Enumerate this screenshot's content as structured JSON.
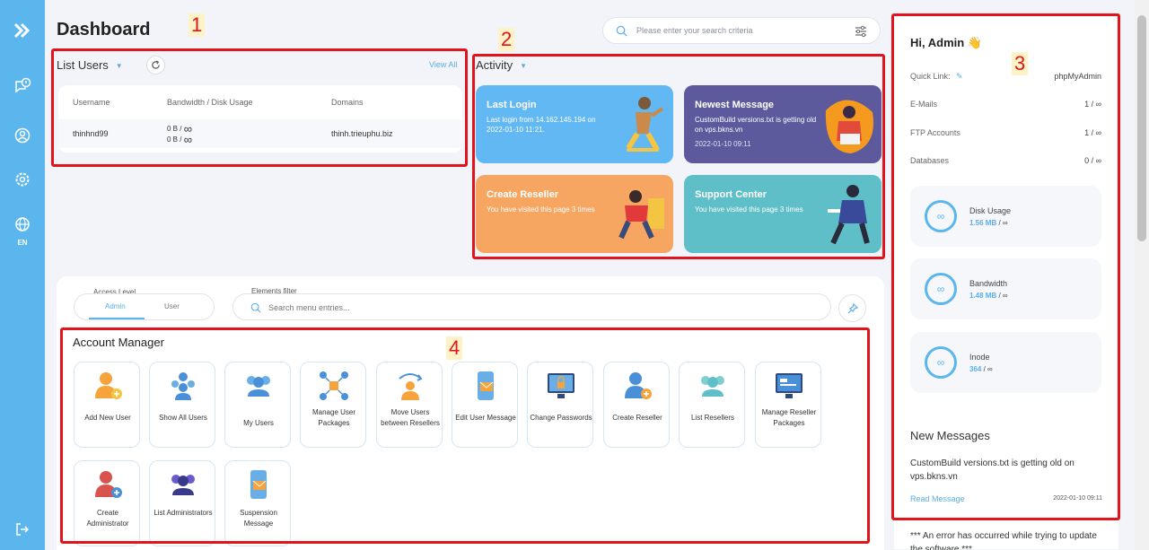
{
  "page": {
    "title": "Dashboard"
  },
  "sidebar": {
    "language": "EN"
  },
  "search": {
    "placeholder": "Please enter your search criteria"
  },
  "list_users": {
    "title": "List Users",
    "view_all": "View All",
    "columns": [
      "Username",
      "Bandwidth / Disk Usage",
      "Domains"
    ],
    "rows": [
      {
        "username": "thinhnd99",
        "bandwidth": "0 B",
        "disk": "0 B",
        "limit": "∞",
        "domain": "thinh.trieuphu.biz"
      }
    ]
  },
  "activity": {
    "title": "Activity",
    "cards": [
      {
        "title": "Last Login",
        "text": "Last login from 14.162.145.194 on 2022-01-10 11:21.",
        "date": "",
        "color": "#62b8f3"
      },
      {
        "title": "Newest Message",
        "text": "CustomBuild versions.txt is getting old on vps.bkns.vn",
        "date": "2022-01-10 09:11",
        "color": "#5c5a9c"
      },
      {
        "title": "Create Reseller",
        "text": "You have visited this page 3 times",
        "date": "",
        "color": "#f7a661"
      },
      {
        "title": "Support Center",
        "text": "You have visited this page 3 times",
        "date": "",
        "color": "#5fbfc9"
      }
    ]
  },
  "user_panel": {
    "greeting": "Hi, Admin 👋",
    "quick_link_label": "Quick Link:",
    "quick_link_value": "phpMyAdmin",
    "stats": [
      {
        "label": "E-Mails",
        "value": "1 / ∞"
      },
      {
        "label": "FTP Accounts",
        "value": "1 / ∞"
      },
      {
        "label": "Databases",
        "value": "0 / ∞"
      }
    ],
    "usage": [
      {
        "label": "Disk Usage",
        "used": "1.56 MB",
        "limit": "∞"
      },
      {
        "label": "Bandwidth",
        "used": "1.48 MB",
        "limit": "∞"
      },
      {
        "label": "Inode",
        "used": "364",
        "limit": "∞"
      }
    ],
    "new_messages_title": "New Messages",
    "message_text": "CustomBuild versions.txt is getting old on vps.bkns.vn",
    "read_message": "Read Message",
    "message_date": "2022-01-10 09:11",
    "error_text": "*** An error has occurred while trying to update the software ***"
  },
  "filters": {
    "access_level_label": "Access Level",
    "access_options": [
      "Admin",
      "User"
    ],
    "elements_filter_label": "Elements filter",
    "elements_filter_placeholder": "Search menu entries..."
  },
  "account_manager": {
    "title": "Account Manager",
    "tiles": [
      {
        "label": "Add New User",
        "icon": "add-user-icon"
      },
      {
        "label": "Show All Users",
        "icon": "users-group-icon"
      },
      {
        "label": "My Users",
        "icon": "my-users-icon"
      },
      {
        "label": "Manage User Packages",
        "icon": "packages-icon"
      },
      {
        "label": "Move Users between Resellers",
        "icon": "move-users-icon"
      },
      {
        "label": "Edit User Message",
        "icon": "edit-message-icon"
      },
      {
        "label": "Change Passwords",
        "icon": "change-password-icon"
      },
      {
        "label": "Create Reseller",
        "icon": "create-reseller-icon"
      },
      {
        "label": "List Resellers",
        "icon": "list-resellers-icon"
      },
      {
        "label": "Manage Reseller Packages",
        "icon": "reseller-packages-icon"
      },
      {
        "label": "Create Administrator",
        "icon": "create-admin-icon"
      },
      {
        "label": "List Administrators",
        "icon": "list-admins-icon"
      },
      {
        "label": "Suspension Message",
        "icon": "suspension-message-icon"
      }
    ]
  },
  "annotations": [
    "1",
    "2",
    "3",
    "4"
  ],
  "colors": {
    "sidebar": "#5cb6ee",
    "accent": "#5aaee8",
    "annotation": "#e1131b"
  }
}
